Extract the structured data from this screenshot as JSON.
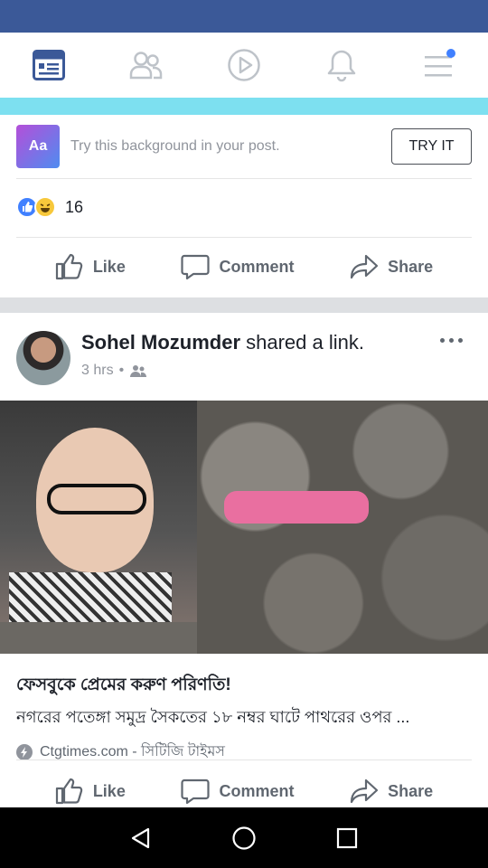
{
  "status_bar": {
    "left_text": "",
    "right_text": ""
  },
  "composer": {
    "aa_label": "Aa",
    "prompt": "Try this background in your post.",
    "try_button": "TRY IT"
  },
  "reactions": {
    "count": "16"
  },
  "actions": {
    "like": "Like",
    "comment": "Comment",
    "share": "Share"
  },
  "post": {
    "author": "Sohel Mozumder",
    "activity": " shared a link.",
    "time": "3 hrs",
    "link_title": "ফেসবুকে প্রেমের করুণ পরিণতি!",
    "link_desc": "নগরের পতেঙ্গা সমুদ্র সৈকতের ১৮ নম্বর ঘাটে পাথরের ওপর ...",
    "link_source": "Ctgtimes.com - সিটিজি টাইমস"
  },
  "colors": {
    "facebook_blue": "#3b5998",
    "accent": "#4080ff"
  }
}
